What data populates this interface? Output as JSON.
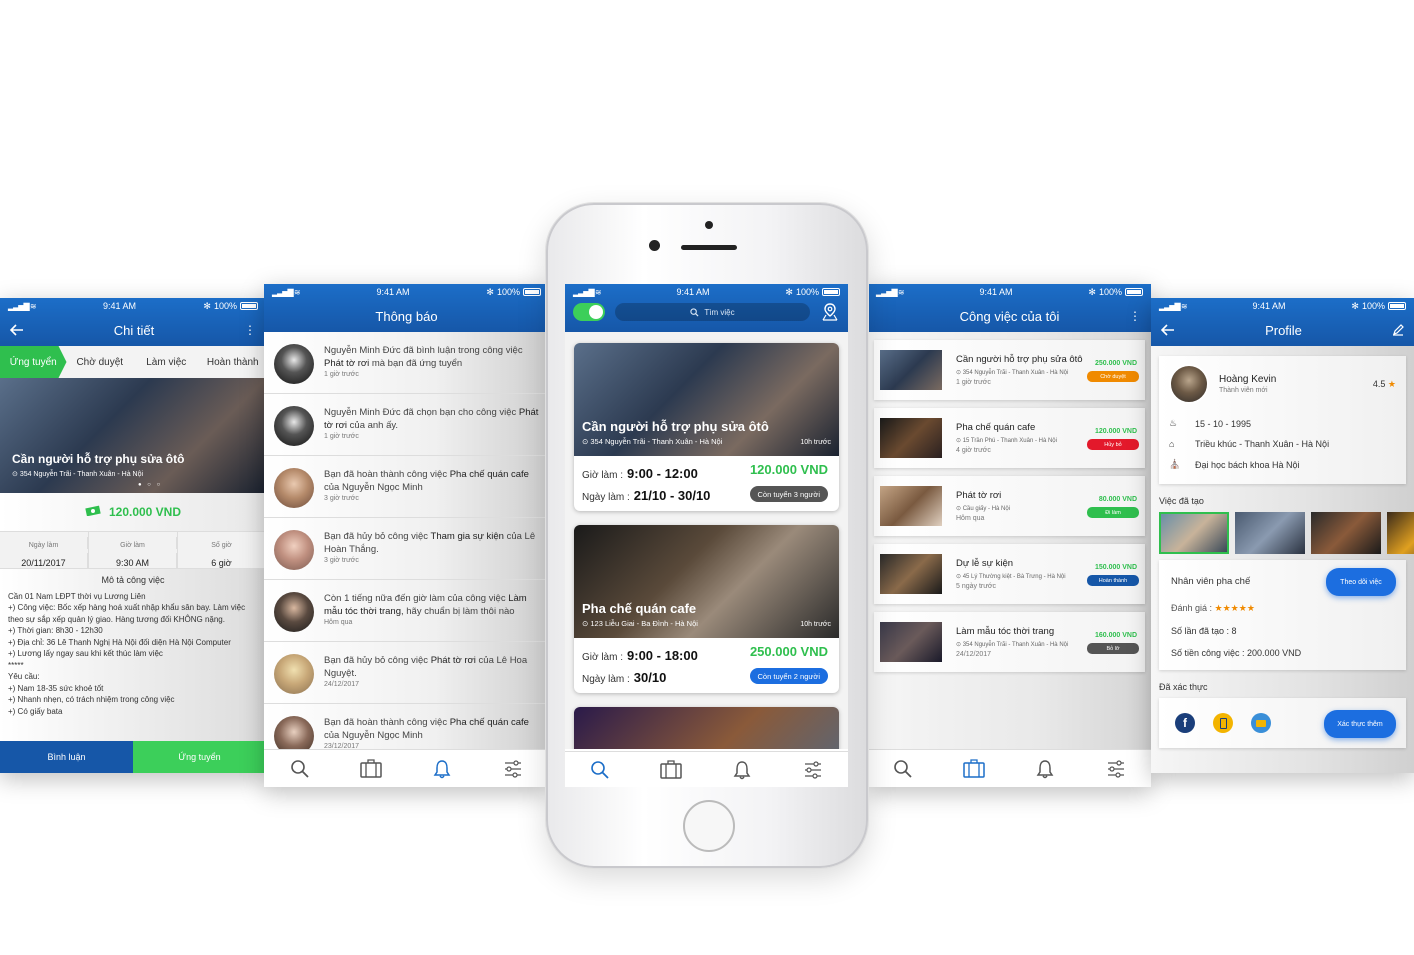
{
  "status": {
    "time": "9:41 AM",
    "battery": "100%"
  },
  "detail": {
    "title": "Chi tiết",
    "steps": [
      "Ứng tuyển",
      "Chờ duyệt",
      "Làm việc",
      "Hoàn thành"
    ],
    "job_title": "Cần người hỗ trợ phụ sửa ôtô",
    "address": "354 Nguyễn Trãi - Thanh Xuân - Hà Nội",
    "price": "120.000 VND",
    "meta": [
      {
        "label": "Ngày làm",
        "value": "20/11/2017"
      },
      {
        "label": "Giờ làm",
        "value": "9:30 AM"
      },
      {
        "label": "Số giờ",
        "value": "6 giờ"
      }
    ],
    "desc_heading": "Mô tả công việc",
    "desc_lines": [
      "Cần 01 Nam LĐPT thời vụ Lương Liên",
      "+) Công việc: Bốc xếp hàng hoá xuất nhập khẩu sân bay. Làm việc theo sự sắp xếp quản lý giao. Hàng tương đối KHÔNG nặng.",
      "+) Thời gian: 8h30 - 12h30",
      "+) Địa chỉ: 36 Lê Thanh Nghị Hà Nội đối diện Hà Nội Computer",
      "+) Lương lấy ngay sau khi kết thúc làm việc",
      "*****",
      "Yêu cầu:",
      "+) Nam 18-35 sức khoẻ tốt",
      "+) Nhanh nhẹn, có trách nhiệm trong công việc",
      "+) Có giấy bata"
    ],
    "comment_label": "Bình luận",
    "apply_label": "Ứng tuyển"
  },
  "notifications": {
    "title": "Thông báo",
    "items": [
      {
        "pre": "Nguyễn Minh Đức",
        "mid": " đã bình luận trong công việc ",
        "obj": "Phát tờ rơi",
        "post": " mà bạn đã ứng tuyển",
        "time": "1 giờ trước"
      },
      {
        "pre": "Nguyễn Minh Đức",
        "mid": " đã chọn bạn cho công việc ",
        "obj": "Phát tờ rơi",
        "post": " của anh ấy.",
        "time": "1 giờ trước"
      },
      {
        "pre": "Bạn đã hoàn thành công việc ",
        "mid": "",
        "obj": "Pha chế quán cafe",
        "post": " của Nguyễn Ngọc Minh",
        "time": "3 giờ trước"
      },
      {
        "pre": "Bạn đã hủy bỏ công việc ",
        "mid": "",
        "obj": "Tham gia sự kiện",
        "post": " của Lê Hoàn Thắng.",
        "time": "3 giờ trước"
      },
      {
        "pre": "Còn 1 tiếng nữa đến giờ làm của công việc ",
        "mid": "",
        "obj": "Làm mẫu tóc thời trang",
        "post": ", hãy chuẩn bị làm thôi nào",
        "time": "Hôm qua"
      },
      {
        "pre": "Bạn đã hủy bỏ công việc ",
        "mid": "",
        "obj": "Phát tờ rơi",
        "post": " của Lê Hoa Nguyệt.",
        "time": "24/12/2017"
      },
      {
        "pre": "Bạn đã hoàn thành công việc ",
        "mid": "",
        "obj": "Pha chế quán cafe",
        "post": " của Nguyễn Ngọc Minh",
        "time": "23/12/2017"
      }
    ]
  },
  "home": {
    "search_placeholder": "Tìm việc",
    "cards": [
      {
        "title": "Cần người hỗ trợ phụ sửa ôtô",
        "address": "354 Nguyễn Trãi - Thanh Xuân - Hà Nội",
        "ago": "10h trước",
        "hours_label": "Giờ làm :",
        "hours": "9:00 - 12:00",
        "date_label": "Ngày làm :",
        "date": "21/10 - 30/10",
        "price": "120.000 VND",
        "badge": "Còn tuyển 3 người",
        "badge_color": "#555555"
      },
      {
        "title": "Pha chế quán cafe",
        "address": "123 Liễu Giai - Ba Đình - Hà Nội",
        "ago": "10h trước",
        "hours_label": "Giờ làm :",
        "hours": "9:00 - 18:00",
        "date_label": "Ngày làm :",
        "date": "30/10",
        "price": "250.000 VND",
        "badge": "Còn tuyển 2 người",
        "badge_color": "#1c6ee0"
      }
    ]
  },
  "myjobs": {
    "title": "Công việc của tôi",
    "items": [
      {
        "title": "Cần người hỗ trợ phụ sửa ôtô",
        "address": "354 Nguyễn Trãi - Thanh Xuân - Hà Nội",
        "time": "1 giờ trước",
        "price": "250.000 VND",
        "status": "Chờ duyệt",
        "color": "#f08a00"
      },
      {
        "title": "Pha chế quán cafe",
        "address": "15 Trần Phú - Thanh Xuân - Hà Nội",
        "time": "4 giờ trước",
        "price": "120.000 VND",
        "status": "Hủy bỏ",
        "color": "#e3192b"
      },
      {
        "title": "Phát tờ rơi",
        "address": "Cầu giấy - Hà Nội",
        "time": "Hôm qua",
        "price": "80.000 VND",
        "status": "Đi làm",
        "color": "#2fbf4e"
      },
      {
        "title": "Dự lễ sự kiện",
        "address": "45 Lý Thường kiệt - Bà Trưng - Hà Nội",
        "time": "5 ngày trước",
        "price": "150.000 VND",
        "status": "Hoàn thành",
        "color": "#1657a8"
      },
      {
        "title": "Làm mẫu tóc thời trang",
        "address": "354 Nguyễn Trãi - Thanh Xuân - Hà Nội",
        "time": "24/12/2017",
        "price": "160.000 VND",
        "status": "Bỏ lỡ",
        "color": "#555555"
      }
    ]
  },
  "profile": {
    "title": "Profile",
    "name": "Hoàng Kevin",
    "role": "Thành viên mới",
    "rating": "4.5",
    "birthday": "15 - 10 - 1995",
    "address": "Triều khúc - Thanh Xuân - Hà Nội",
    "school": "Đại học bách khoa Hà Nội",
    "created_heading": "Việc đã tạo",
    "job_name": "Nhân viên pha chế",
    "follow_label": "Theo dõi việc",
    "rate_label": "Đánh giá :",
    "count_label": "Số lần đã tạo : 8",
    "money_label": "Số tiền công việc : 200.000 VND",
    "verified_heading": "Đã xác thực",
    "verify_label": "Xác thực thêm"
  },
  "colors": {
    "primary": "#1c6ec8",
    "green": "#2fbf4e",
    "accent_blue": "#1c6ee0"
  }
}
